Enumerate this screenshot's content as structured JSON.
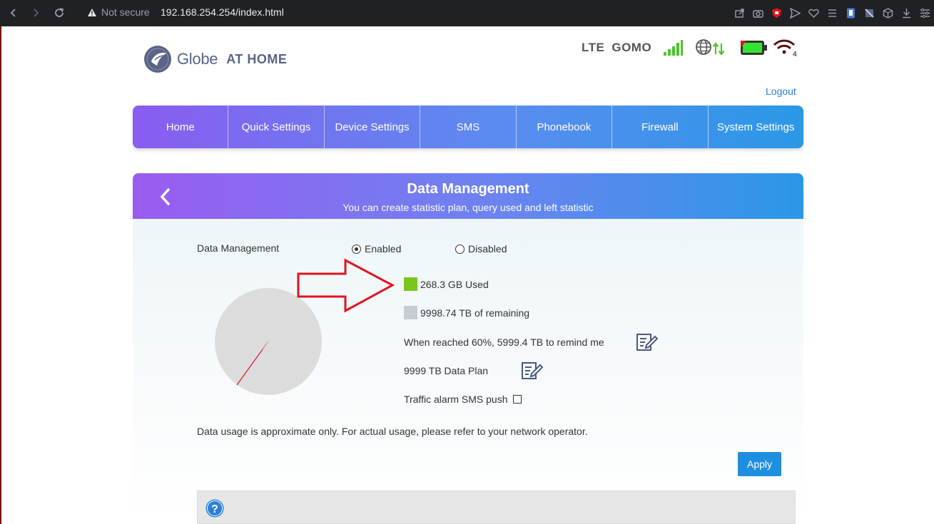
{
  "browser": {
    "security_label": "Not secure",
    "url": "192.168.254.254/index.html",
    "toolbar_icons": [
      "share-icon",
      "camera-icon",
      "shield-icon",
      "send-icon",
      "heart-icon",
      "menu-list-icon",
      "extension-icon",
      "puzzle-icon",
      "cube-icon",
      "download-icon",
      "settings-sliders-icon"
    ]
  },
  "header": {
    "logo_text": "Globe",
    "logo_sub": "AT HOME",
    "network_type": "LTE",
    "operator": "GOMO",
    "wifi_clients": "4",
    "logout": "Logout"
  },
  "menu": {
    "items": [
      "Home",
      "Quick Settings",
      "Device Settings",
      "SMS",
      "Phonebook",
      "Firewall",
      "System Settings"
    ]
  },
  "panel": {
    "title": "Data Management",
    "subtitle": "You can create statistic plan, query used and left statistic"
  },
  "form": {
    "data_management_label": "Data Management",
    "enabled_label": "Enabled",
    "disabled_label": "Disabled",
    "selected": "Enabled",
    "used_text": "268.3 GB Used",
    "remaining_text": "9998.74 TB of remaining",
    "remind_text": "When reached 60%, 5999.4 TB to remind me",
    "plan_text": "9999 TB Data Plan",
    "sms_push_text": "Traffic alarm SMS push",
    "sms_push_checked": false,
    "note": "Data usage is approximate only. For actual usage, please refer to your network operator.",
    "apply_label": "Apply"
  },
  "colors": {
    "used": "#7cc41e",
    "remaining": "#c4cdd6",
    "pie_fill": "#dcdcdc",
    "accent_blue": "#1e8fe0",
    "arrow_red": "#e0141e"
  }
}
